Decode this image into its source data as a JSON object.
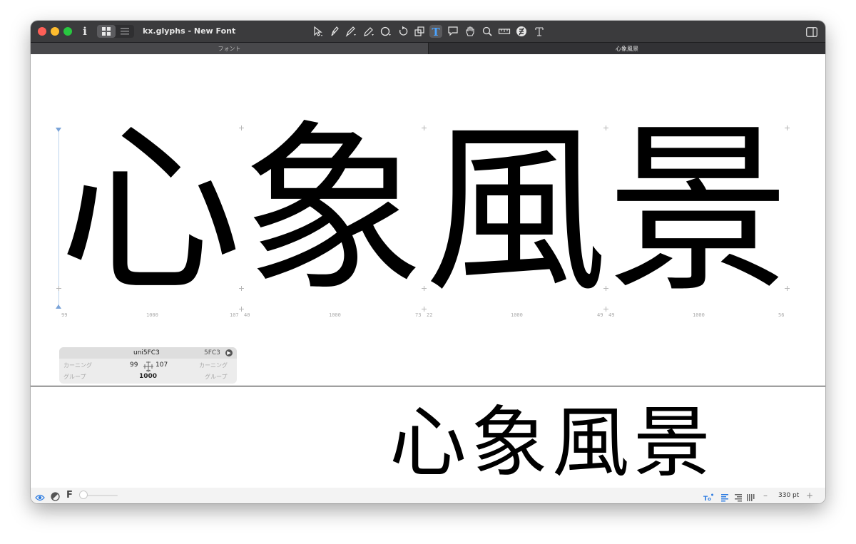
{
  "window": {
    "title": "kx.glyphs - New Font"
  },
  "tabs": [
    {
      "label": "フォント"
    },
    {
      "label": "心象風景"
    }
  ],
  "toolbar": {
    "icons": [
      "select-tool-icon",
      "draw-tool-icon",
      "pen-tool-icon",
      "pencil-tool-icon",
      "primitives-tool-icon",
      "rotate-tool-icon",
      "scale-tool-icon",
      "text-tool-icon",
      "annotation-tool-icon",
      "hand-tool-icon",
      "zoom-tool-icon",
      "measure-tool-icon",
      "knife-tool-icon",
      "sidebearing-tool-icon"
    ],
    "active_tool": "text-tool-icon"
  },
  "canvas": {
    "glyphs": [
      {
        "char": "心",
        "lsb": "99",
        "width": "1000",
        "rsb": "107"
      },
      {
        "char": "象",
        "lsb": "40",
        "width": "1000",
        "rsb": "73"
      },
      {
        "char": "風",
        "lsb": "22",
        "width": "1000",
        "rsb": "49"
      },
      {
        "char": "景",
        "lsb": "49",
        "width": "1000",
        "rsb": "56"
      }
    ]
  },
  "info_panel": {
    "glyph_name": "uni5FC3",
    "unicode": "5FC3",
    "left_kerning_label": "カーニング",
    "left_group_label": "グループ",
    "right_kerning_label": "カーニング",
    "right_group_label": "グループ",
    "lsb": "99",
    "rsb": "107",
    "width": "1000"
  },
  "preview": {
    "text": "心象風景"
  },
  "statusbar": {
    "font_size": "330 pt",
    "minus": "–",
    "plus": "+",
    "f_label": "F"
  },
  "colors": {
    "titlebar": "#3b3b3d",
    "accent_blue": "#2f7de1",
    "ruler_blue": "#7aa3d8"
  }
}
